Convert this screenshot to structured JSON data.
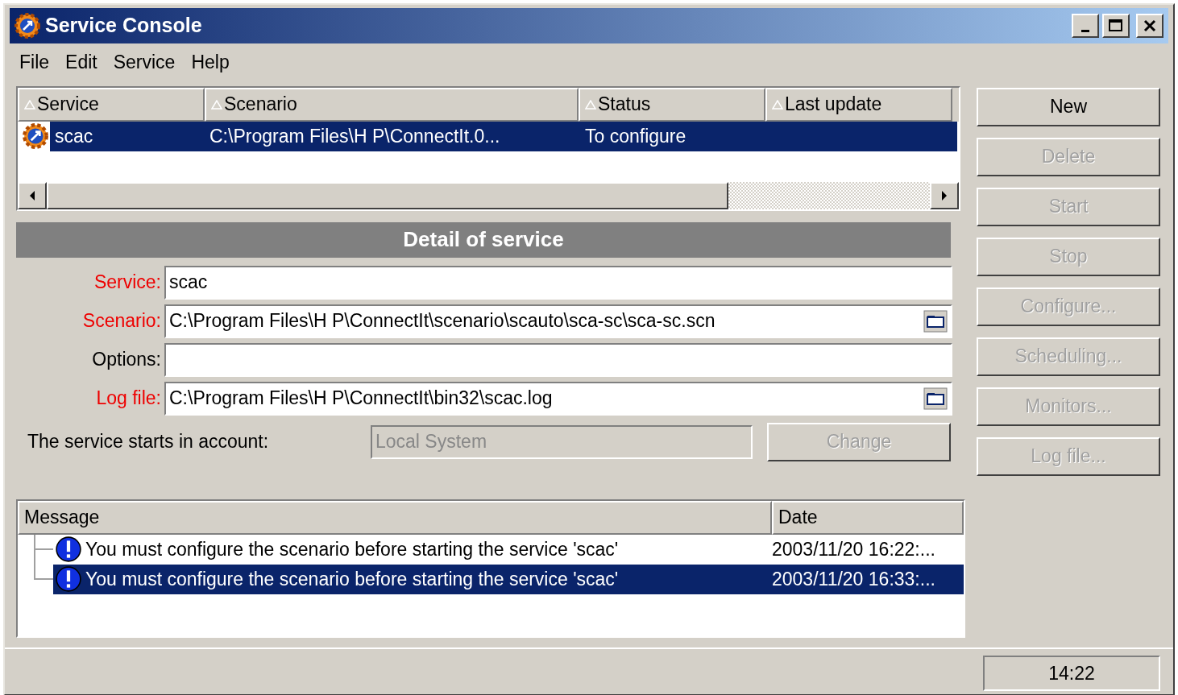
{
  "window": {
    "title": "Service Console"
  },
  "menu": [
    {
      "label": "File"
    },
    {
      "label": "Edit"
    },
    {
      "label": "Service"
    },
    {
      "label": "Help"
    }
  ],
  "services_table": {
    "columns": [
      {
        "label": "Service"
      },
      {
        "label": "Scenario"
      },
      {
        "label": "Status"
      },
      {
        "label": "Last update"
      }
    ],
    "rows": [
      {
        "service": "scac",
        "scenario": "C:\\Program Files\\H P\\ConnectIt.0...",
        "status": "To configure",
        "selected": true
      }
    ]
  },
  "detail": {
    "title": "Detail of service",
    "fields": [
      {
        "label": "Service:",
        "value": "scac",
        "required": true,
        "browse": false
      },
      {
        "label": "Scenario:",
        "value": "C:\\Program Files\\H P\\ConnectIt\\scenario\\scauto\\sca-sc\\sca-sc.scn",
        "required": true,
        "browse": true
      },
      {
        "label": "Options:",
        "required": false,
        "browse": false
      },
      {
        "label": "Log file:",
        "value": "C:\\Program Files\\H P\\ConnectIt\\bin32\\scac.log",
        "required": true,
        "browse": true
      }
    ],
    "account": {
      "label": "The service starts in account:",
      "value": "Local System",
      "disabled": true
    },
    "change_button": {
      "label": "Change",
      "disabled": true
    }
  },
  "messages": {
    "columns": [
      {
        "label": "Message"
      },
      {
        "label": "Date"
      }
    ],
    "rows": [
      {
        "message": "You must configure the scenario before starting the service 'scac'",
        "date": "2003/11/20 16:22:...",
        "selected": false
      },
      {
        "message": "You must configure the scenario before starting the service 'scac'",
        "date": "2003/11/20 16:33:...",
        "selected": true
      }
    ]
  },
  "buttons": [
    {
      "label": "New",
      "disabled": false
    },
    {
      "label": "Delete",
      "disabled": true
    },
    {
      "label": "Start",
      "disabled": true
    },
    {
      "label": "Stop",
      "disabled": true
    },
    {
      "label": "Configure...",
      "disabled": true
    },
    {
      "label": "Scheduling...",
      "disabled": true
    },
    {
      "label": "Monitors...",
      "disabled": true
    },
    {
      "label": "Log file...",
      "disabled": true
    }
  ],
  "status_bar": {
    "time": "14:22"
  }
}
